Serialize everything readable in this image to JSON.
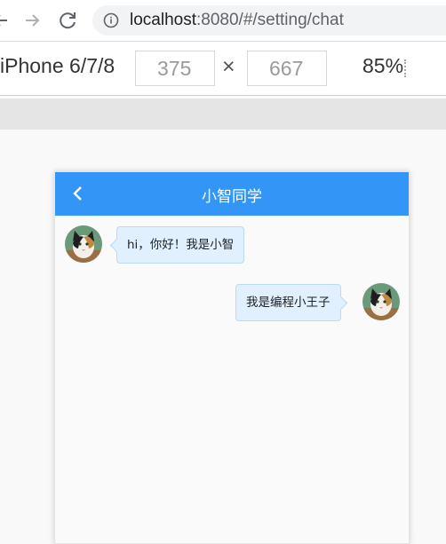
{
  "browser": {
    "url_host": "localhost",
    "url_rest": ":8080/#/setting/chat",
    "icons": {
      "back": "arrow-left-icon",
      "forward": "arrow-right-icon",
      "reload": "reload-icon",
      "info": "info-icon"
    }
  },
  "devtools": {
    "device": "iPhone 6/7/8",
    "width": "375",
    "height": "667",
    "times": "×",
    "zoom": "85%"
  },
  "chat": {
    "title": "小智同学",
    "header_color": "#3395f5",
    "bubble_color": "#e0f0ff",
    "messages": [
      {
        "side": "left",
        "text": "hi，你好！我是小智"
      },
      {
        "side": "right",
        "text": "我是编程小王子"
      }
    ]
  }
}
